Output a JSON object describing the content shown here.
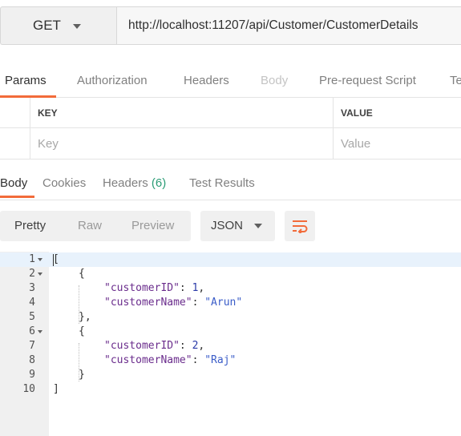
{
  "request": {
    "method": "GET",
    "url": "http://localhost:11207/api/Customer/CustomerDetails",
    "icons": {
      "method_caret": "chevron-down-icon"
    }
  },
  "request_tabs": [
    {
      "label": "Params",
      "active": true
    },
    {
      "label": "Authorization",
      "active": false
    },
    {
      "label": "Headers",
      "active": false
    },
    {
      "label": "Body",
      "active": false,
      "disabled": true
    },
    {
      "label": "Pre-request Script",
      "active": false
    },
    {
      "label": "Te",
      "active": false
    }
  ],
  "params_table": {
    "columns": [
      "KEY",
      "VALUE"
    ],
    "placeholders": {
      "key": "Key",
      "value": "Value"
    }
  },
  "response_tabs": [
    {
      "label": "Body",
      "active": true
    },
    {
      "label": "Cookies",
      "active": false
    },
    {
      "label": "Headers",
      "count": "(6)",
      "active": false
    },
    {
      "label": "Test Results",
      "active": false
    }
  ],
  "response_toolbar": {
    "views": [
      "Pretty",
      "Raw",
      "Preview"
    ],
    "active_view": "Pretty",
    "format": "JSON",
    "wrap_icon": "wrap-lines-icon"
  },
  "response_body": {
    "lines": [
      {
        "n": "1",
        "fold": true,
        "text": "["
      },
      {
        "n": "2",
        "fold": true,
        "text": "{"
      },
      {
        "n": "3",
        "fold": false,
        "key": "\"customerID\"",
        "value": "1",
        "value_type": "number",
        "trail": ","
      },
      {
        "n": "4",
        "fold": false,
        "key": "\"customerName\"",
        "value": "\"Arun\"",
        "value_type": "string",
        "trail": ""
      },
      {
        "n": "5",
        "fold": false,
        "text": "},"
      },
      {
        "n": "6",
        "fold": true,
        "text": "{"
      },
      {
        "n": "7",
        "fold": false,
        "key": "\"customerID\"",
        "value": "2",
        "value_type": "number",
        "trail": ","
      },
      {
        "n": "8",
        "fold": false,
        "key": "\"customerName\"",
        "value": "\"Raj\"",
        "value_type": "string",
        "trail": ""
      },
      {
        "n": "9",
        "fold": false,
        "text": "}"
      },
      {
        "n": "10",
        "fold": false,
        "text": "]"
      }
    ]
  },
  "colors": {
    "accent": "#f26b3a",
    "count": "#2b9c76",
    "json_key": "#6a2c8c",
    "json_number": "#2a3aa8",
    "json_string": "#3a5cc8"
  }
}
